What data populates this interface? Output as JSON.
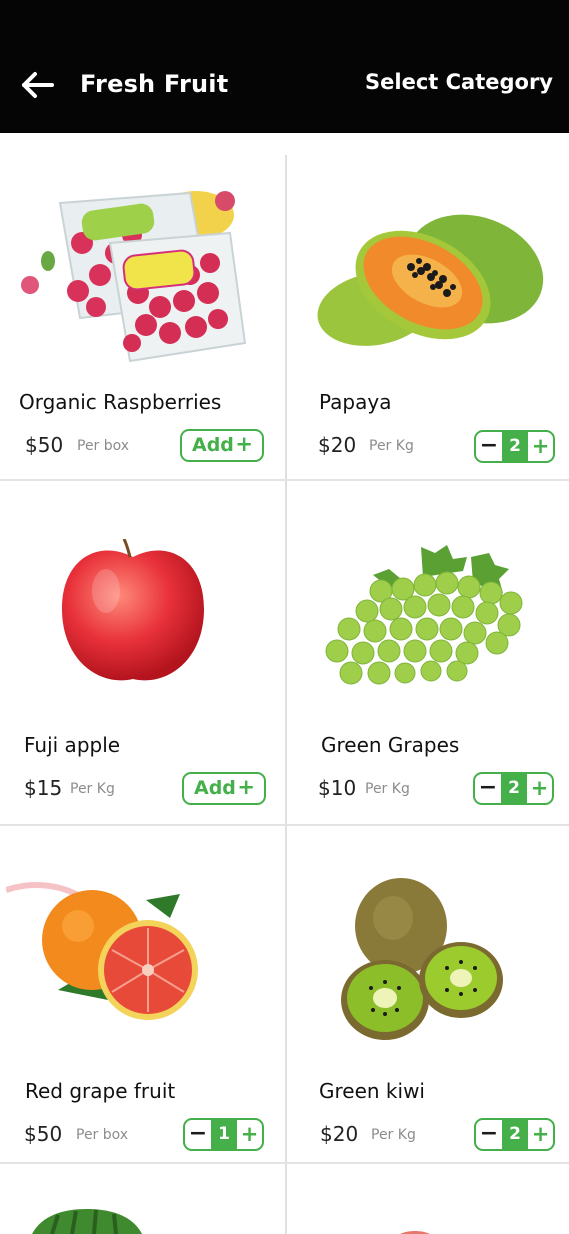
{
  "header": {
    "title": "Fresh Fruit",
    "select_category": "Select Category",
    "back_icon": "arrow-left-icon"
  },
  "colors": {
    "accent": "#45b04a",
    "header_bg": "#050505"
  },
  "products": [
    {
      "name": "Organic Raspberries",
      "price": "$50",
      "unit": "Per box",
      "action": "add",
      "add_label": "Add",
      "plus": "+"
    },
    {
      "name": "Papaya",
      "price": "$20",
      "unit": "Per Kg",
      "action": "stepper",
      "minus": "−",
      "qty": "2",
      "plus": "+"
    },
    {
      "name": "Fuji apple",
      "price": "$15",
      "unit": "Per Kg",
      "action": "add",
      "add_label": "Add",
      "plus": "+"
    },
    {
      "name": "Green Grapes",
      "price": "$10",
      "unit": "Per Kg",
      "action": "stepper",
      "minus": "−",
      "qty": "2",
      "plus": "+"
    },
    {
      "name": "Red grape fruit",
      "price": "$50",
      "unit": "Per box",
      "action": "stepper",
      "minus": "−",
      "qty": "1",
      "plus": "+"
    },
    {
      "name": "Green kiwi",
      "price": "$20",
      "unit": "Per Kg",
      "action": "stepper",
      "minus": "−",
      "qty": "2",
      "plus": "+"
    }
  ]
}
